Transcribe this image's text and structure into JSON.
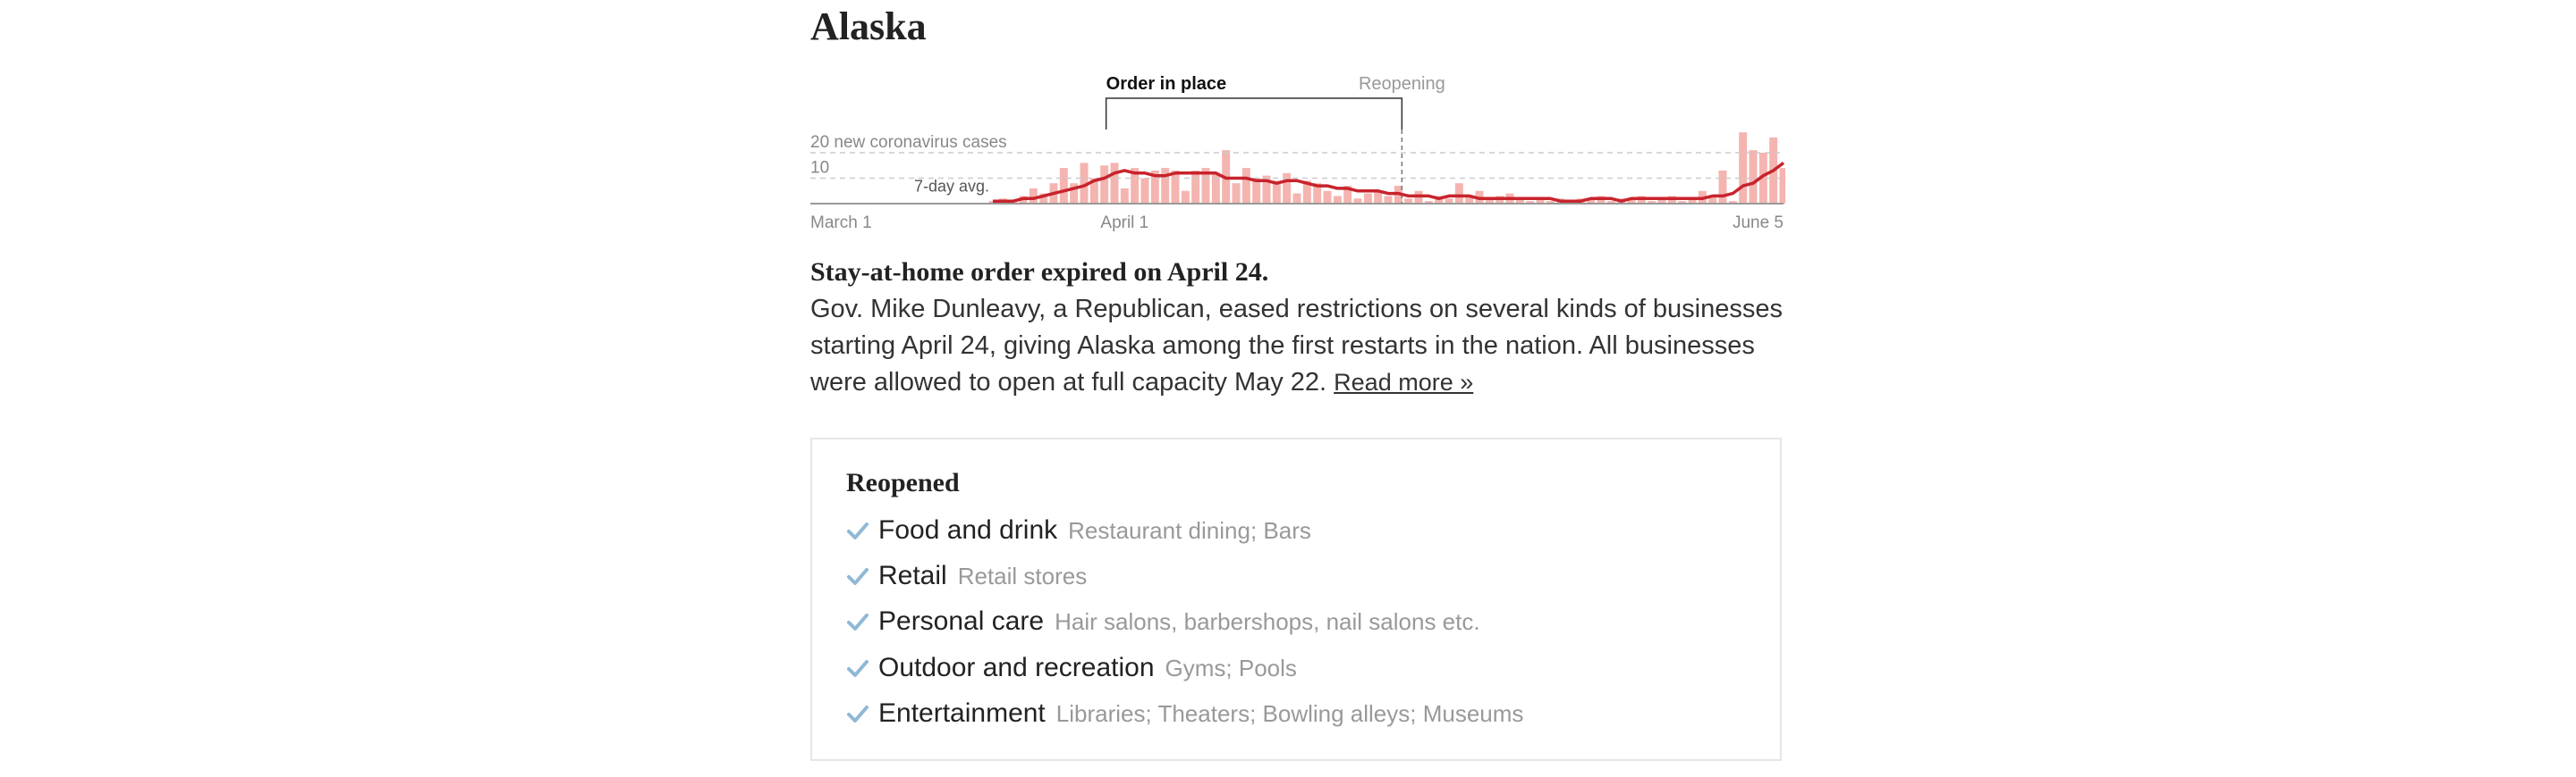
{
  "state": "Alaska",
  "chart_data": {
    "type": "bar",
    "ylabel_top": "20 new coronavirus cases",
    "ytick_mid": "10",
    "yticks": [
      10,
      20
    ],
    "ylim": [
      0,
      20
    ],
    "x_labels": [
      {
        "label": "March 1",
        "day": 0,
        "anchor": "start"
      },
      {
        "label": "April 1",
        "day": 31,
        "anchor": "middle"
      },
      {
        "label": "June 5",
        "day": 96,
        "anchor": "end"
      }
    ],
    "avg_label": "7-day avg.",
    "annotations": {
      "order_label": "Order in place",
      "reopen_label": "Reopening",
      "order_start_day": 29,
      "order_end_day": 58
    },
    "colors": {
      "bars": "#f4b4b0",
      "line": "#c8232c",
      "grid": "#cccccc",
      "axis": "#999999"
    },
    "daily_cases": [
      0,
      0,
      0,
      0,
      0,
      0,
      0,
      0,
      0,
      0,
      0,
      0,
      0,
      0,
      0,
      0,
      0,
      0,
      1,
      2,
      1,
      3,
      6,
      4,
      8,
      14,
      8,
      16,
      10,
      15,
      16,
      6,
      14,
      10,
      13,
      14,
      13,
      5,
      13,
      14,
      12,
      21,
      8,
      14,
      10,
      11,
      9,
      12,
      4,
      9,
      8,
      5,
      3,
      7,
      2,
      4,
      5,
      3,
      7,
      2,
      5,
      1,
      3,
      2,
      8,
      3,
      5,
      2,
      3,
      4,
      2,
      1,
      2,
      1,
      2,
      1,
      2,
      2,
      3,
      1,
      2,
      2,
      3,
      1,
      2,
      3,
      1,
      2,
      5,
      3,
      13,
      1,
      28,
      21,
      20,
      26,
      14
    ],
    "seven_day_avg": [
      0,
      0,
      0,
      0,
      0,
      0,
      0,
      0,
      0,
      0,
      0,
      0,
      0,
      0,
      0,
      0,
      0,
      0,
      1,
      1,
      1,
      2,
      2,
      3,
      4,
      5,
      6,
      7,
      9,
      10,
      12,
      13,
      12,
      12,
      11,
      11,
      12,
      12,
      12,
      12,
      12,
      10,
      10,
      10,
      9,
      9,
      8,
      9,
      9,
      8,
      7,
      7,
      6,
      6,
      5,
      5,
      5,
      4,
      4,
      3,
      3,
      3,
      2,
      3,
      3,
      3,
      2,
      2,
      2,
      2,
      2,
      2,
      2,
      2,
      1,
      1,
      1,
      2,
      2,
      2,
      1,
      2,
      2,
      2,
      2,
      2,
      2,
      2,
      2,
      3,
      3,
      4,
      7,
      8,
      11,
      13,
      16
    ]
  },
  "status": {
    "headline": "Stay-at-home order expired on April 24.",
    "body": "Gov. Mike Dunleavy, a Republican, eased restrictions on several kinds of businesses starting April 24, giving Alaska among the first restarts in the nation. All businesses were allowed to open at full capacity May 22.",
    "read_more": "Read more »"
  },
  "reopened": {
    "title": "Reopened",
    "check_color": "#8fb8d6",
    "categories": [
      {
        "name": "Food and drink",
        "detail": "Restaurant dining; Bars"
      },
      {
        "name": "Retail",
        "detail": "Retail stores"
      },
      {
        "name": "Personal care",
        "detail": "Hair salons, barbershops, nail salons etc."
      },
      {
        "name": "Outdoor and recreation",
        "detail": "Gyms; Pools"
      },
      {
        "name": "Entertainment",
        "detail": "Libraries; Theaters; Bowling alleys; Museums"
      }
    ]
  }
}
